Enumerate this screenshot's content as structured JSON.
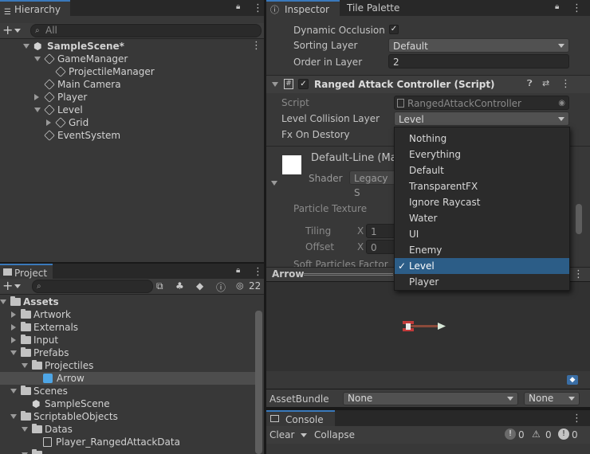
{
  "hierarchy": {
    "tab_label": "Hierarchy",
    "search_placeholder": "All",
    "scene_name": "SampleScene*",
    "items": [
      {
        "label": "GameManager"
      },
      {
        "label": "ProjectileManager"
      },
      {
        "label": "Main Camera"
      },
      {
        "label": "Player"
      },
      {
        "label": "Level"
      },
      {
        "label": "Grid"
      },
      {
        "label": "EventSystem"
      }
    ]
  },
  "project": {
    "tab_label": "Project",
    "hidden_count": "22",
    "tree": [
      {
        "label": "Assets"
      },
      {
        "label": "Artwork"
      },
      {
        "label": "Externals"
      },
      {
        "label": "Input"
      },
      {
        "label": "Prefabs"
      },
      {
        "label": "Projectiles"
      },
      {
        "label": "Arrow"
      },
      {
        "label": "Scenes"
      },
      {
        "label": "SampleScene"
      },
      {
        "label": "ScriptableObjects"
      },
      {
        "label": "Datas"
      },
      {
        "label": "Player_RangedAttackData"
      }
    ]
  },
  "inspector": {
    "tabs": [
      {
        "label": "Inspector"
      },
      {
        "label": "Tile Palette"
      }
    ],
    "dynamic_occlusion_label": "Dynamic Occlusion",
    "sorting_layer_label": "Sorting Layer",
    "sorting_layer_value": "Default",
    "order_in_layer_label": "Order in Layer",
    "order_in_layer_value": "2",
    "component_title": "Ranged Attack Controller (Script)",
    "script_label": "Script",
    "script_value": "RangedAttackController",
    "level_collision_label": "Level Collision Layer",
    "level_collision_value": "Level",
    "fx_label": "Fx On Destory",
    "material_name": "Default-Line (Ma",
    "shader_label": "Shader",
    "shader_value": "Legacy S",
    "particle_texture_label": "Particle Texture",
    "tiling_label": "Tiling",
    "offset_label": "Offset",
    "x_label": "X",
    "tiling_x": "1",
    "offset_x": "0",
    "soft_particles_label": "Soft Particles Factor"
  },
  "layer_menu": {
    "items": [
      {
        "label": "Nothing",
        "selected": false
      },
      {
        "label": "Everything",
        "selected": false
      },
      {
        "label": "Default",
        "selected": false
      },
      {
        "label": "TransparentFX",
        "selected": false
      },
      {
        "label": "Ignore Raycast",
        "selected": false
      },
      {
        "label": "Water",
        "selected": false
      },
      {
        "label": "UI",
        "selected": false
      },
      {
        "label": "Enemy",
        "selected": false
      },
      {
        "label": "Level",
        "selected": true
      },
      {
        "label": "Player",
        "selected": false
      }
    ],
    "check_glyph": "✓"
  },
  "preview": {
    "title": "Arrow",
    "asset_bundle_label": "AssetBundle",
    "asset_bundle_value": "None",
    "variant_value": "None"
  },
  "console": {
    "tab_label": "Console",
    "clear_label": "Clear",
    "collapse_label": "Collapse",
    "info_count": "0",
    "warning_count": "0",
    "error_count": "0"
  },
  "colors": {
    "accent": "#3a79bb",
    "selection": "#2c5d87",
    "panel": "#383838"
  }
}
